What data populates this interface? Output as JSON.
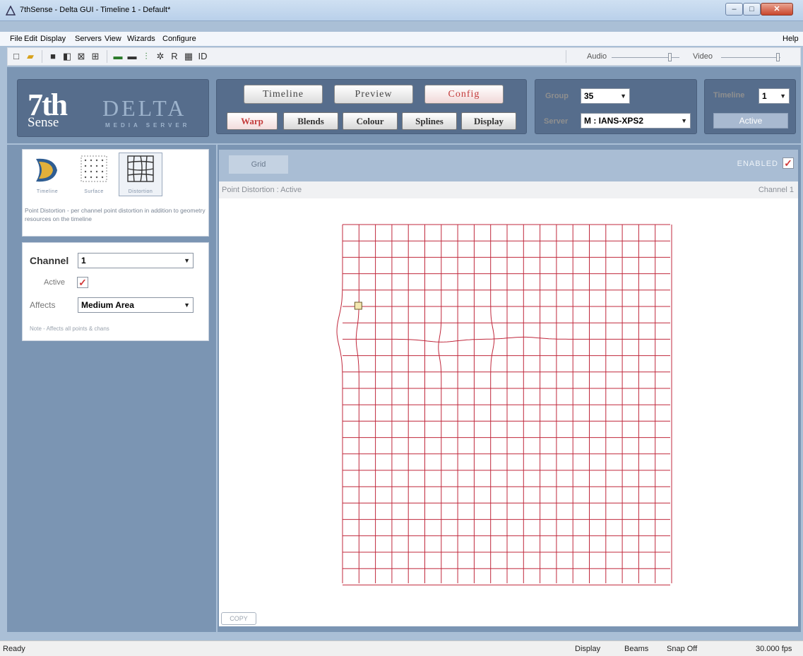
{
  "window": {
    "title": "7thSense - Delta GUI - Timeline 1 - Default*",
    "min_glyph": "–",
    "max_glyph": "□",
    "close_glyph": "✕"
  },
  "menu": {
    "items": [
      "File",
      "Edit",
      "Display",
      "Servers",
      "View",
      "Wizards",
      "Configure"
    ],
    "help": "Help"
  },
  "toolbar": {
    "audio_label": "Audio",
    "video_label": "Video",
    "audio_level": 0.85,
    "video_level": 0.95
  },
  "logo": {
    "seven": "7th",
    "sense": "Sense",
    "delta": "DELTA",
    "media_server": "MEDIA SERVER"
  },
  "modes": {
    "timeline": "Timeline",
    "preview": "Preview",
    "config": "Config",
    "selected": "config"
  },
  "subtabs": {
    "warp": "Warp",
    "blends": "Blends",
    "colour": "Colour",
    "splines": "Splines",
    "display": "Display",
    "selected": "warp"
  },
  "group": {
    "label": "Group",
    "value": "35",
    "server_label": "Server",
    "server_value": "M : IANS-XPS2"
  },
  "timeline_panel": {
    "label": "Timeline",
    "value": "1",
    "status": "Active"
  },
  "left": {
    "tiles": [
      {
        "caption": "Timeline"
      },
      {
        "caption": "Surface"
      },
      {
        "caption": "Distortion"
      }
    ],
    "description": "Point Distortion - per channel point distortion in addition to geometry resources on the timeline",
    "channel_label": "Channel",
    "channel_value": "1",
    "active_label": "Active",
    "active_checked": true,
    "affects_label": "Affects",
    "affects_value": "Medium Area",
    "note": "Note - Affects all points & chans"
  },
  "main": {
    "tab": "Grid",
    "enabled_label": "ENABLED",
    "enabled_checked": true,
    "status_left": "Point Distortion : Active",
    "status_right": "Channel 1",
    "copy_label": "COPY",
    "grid_color": "#c0283c"
  },
  "statusbar": {
    "ready": "Ready",
    "display": "Display",
    "beams": "Beams",
    "snap": "Snap Off",
    "fps": "30.000 fps"
  }
}
